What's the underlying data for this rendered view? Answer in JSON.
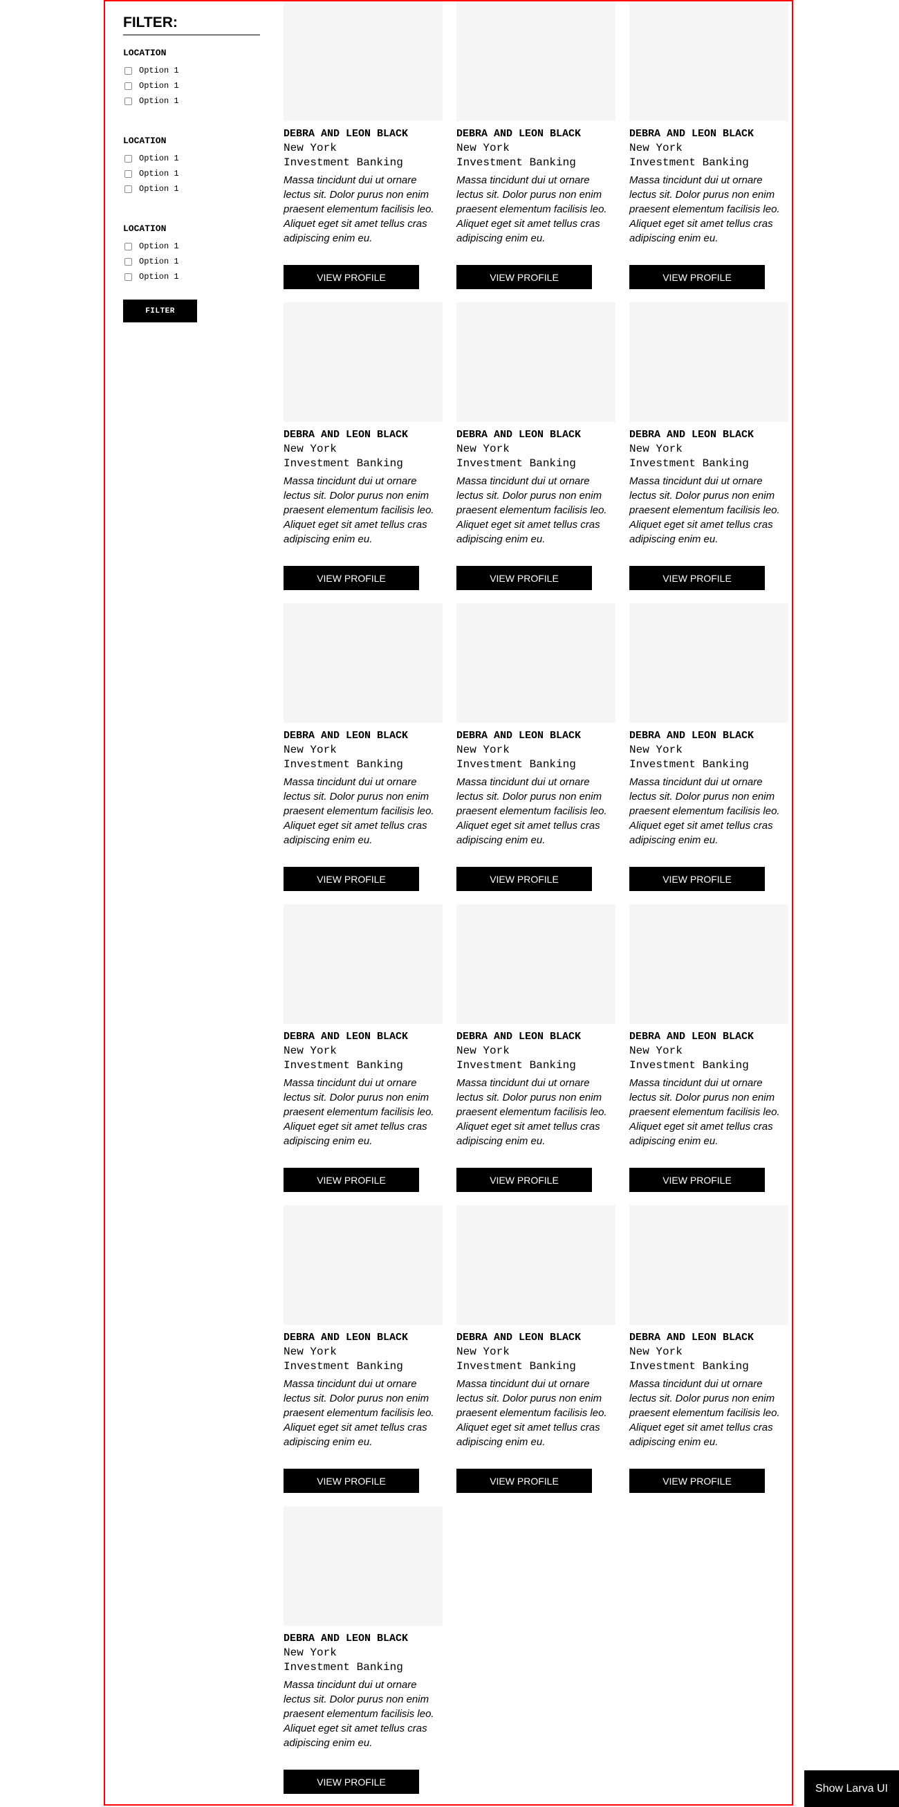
{
  "sidebar": {
    "title": "FILTER:",
    "groups": [
      {
        "title": "LOCATION",
        "options": [
          "Option 1",
          "Option 1",
          "Option 1"
        ]
      },
      {
        "title": "LOCATION",
        "options": [
          "Option 1",
          "Option 1",
          "Option 1"
        ]
      },
      {
        "title": "LOCATION",
        "options": [
          "Option 1",
          "Option 1",
          "Option 1"
        ]
      }
    ],
    "filter_button": "FILTER"
  },
  "profiles": [
    {
      "name": "DEBRA AND LEON BLACK",
      "location": "New York",
      "industry": "Investment Banking",
      "description": "Massa tincidunt dui ut ornare lectus sit. Dolor purus non enim praesent elementum facilisis leo. Aliquet eget sit amet tellus cras adipiscing enim eu.",
      "button": "VIEW PROFILE"
    },
    {
      "name": "DEBRA AND LEON BLACK",
      "location": "New York",
      "industry": "Investment Banking",
      "description": "Massa tincidunt dui ut ornare lectus sit. Dolor purus non enim praesent elementum facilisis leo. Aliquet eget sit amet tellus cras adipiscing enim eu.",
      "button": "VIEW PROFILE"
    },
    {
      "name": "DEBRA AND LEON BLACK",
      "location": "New York",
      "industry": "Investment Banking",
      "description": "Massa tincidunt dui ut ornare lectus sit. Dolor purus non enim praesent elementum facilisis leo. Aliquet eget sit amet tellus cras adipiscing enim eu.",
      "button": "VIEW PROFILE"
    },
    {
      "name": "DEBRA AND LEON BLACK",
      "location": "New York",
      "industry": "Investment Banking",
      "description": "Massa tincidunt dui ut ornare lectus sit. Dolor purus non enim praesent elementum facilisis leo. Aliquet eget sit amet tellus cras adipiscing enim eu.",
      "button": "VIEW PROFILE"
    },
    {
      "name": "DEBRA AND LEON BLACK",
      "location": "New York",
      "industry": "Investment Banking",
      "description": "Massa tincidunt dui ut ornare lectus sit. Dolor purus non enim praesent elementum facilisis leo. Aliquet eget sit amet tellus cras adipiscing enim eu.",
      "button": "VIEW PROFILE"
    },
    {
      "name": "DEBRA AND LEON BLACK",
      "location": "New York",
      "industry": "Investment Banking",
      "description": "Massa tincidunt dui ut ornare lectus sit. Dolor purus non enim praesent elementum facilisis leo. Aliquet eget sit amet tellus cras adipiscing enim eu.",
      "button": "VIEW PROFILE"
    },
    {
      "name": "DEBRA AND LEON BLACK",
      "location": "New York",
      "industry": "Investment Banking",
      "description": "Massa tincidunt dui ut ornare lectus sit. Dolor purus non enim praesent elementum facilisis leo. Aliquet eget sit amet tellus cras adipiscing enim eu.",
      "button": "VIEW PROFILE"
    },
    {
      "name": "DEBRA AND LEON BLACK",
      "location": "New York",
      "industry": "Investment Banking",
      "description": "Massa tincidunt dui ut ornare lectus sit. Dolor purus non enim praesent elementum facilisis leo. Aliquet eget sit amet tellus cras adipiscing enim eu.",
      "button": "VIEW PROFILE"
    },
    {
      "name": "DEBRA AND LEON BLACK",
      "location": "New York",
      "industry": "Investment Banking",
      "description": "Massa tincidunt dui ut ornare lectus sit. Dolor purus non enim praesent elementum facilisis leo. Aliquet eget sit amet tellus cras adipiscing enim eu.",
      "button": "VIEW PROFILE"
    },
    {
      "name": "DEBRA AND LEON BLACK",
      "location": "New York",
      "industry": "Investment Banking",
      "description": "Massa tincidunt dui ut ornare lectus sit. Dolor purus non enim praesent elementum facilisis leo. Aliquet eget sit amet tellus cras adipiscing enim eu.",
      "button": "VIEW PROFILE"
    },
    {
      "name": "DEBRA AND LEON BLACK",
      "location": "New York",
      "industry": "Investment Banking",
      "description": "Massa tincidunt dui ut ornare lectus sit. Dolor purus non enim praesent elementum facilisis leo. Aliquet eget sit amet tellus cras adipiscing enim eu.",
      "button": "VIEW PROFILE"
    },
    {
      "name": "DEBRA AND LEON BLACK",
      "location": "New York",
      "industry": "Investment Banking",
      "description": "Massa tincidunt dui ut ornare lectus sit. Dolor purus non enim praesent elementum facilisis leo. Aliquet eget sit amet tellus cras adipiscing enim eu.",
      "button": "VIEW PROFILE"
    },
    {
      "name": "DEBRA AND LEON BLACK",
      "location": "New York",
      "industry": "Investment Banking",
      "description": "Massa tincidunt dui ut ornare lectus sit. Dolor purus non enim praesent elementum facilisis leo. Aliquet eget sit amet tellus cras adipiscing enim eu.",
      "button": "VIEW PROFILE"
    },
    {
      "name": "DEBRA AND LEON BLACK",
      "location": "New York",
      "industry": "Investment Banking",
      "description": "Massa tincidunt dui ut ornare lectus sit. Dolor purus non enim praesent elementum facilisis leo. Aliquet eget sit amet tellus cras adipiscing enim eu.",
      "button": "VIEW PROFILE"
    },
    {
      "name": "DEBRA AND LEON BLACK",
      "location": "New York",
      "industry": "Investment Banking",
      "description": "Massa tincidunt dui ut ornare lectus sit. Dolor purus non enim praesent elementum facilisis leo. Aliquet eget sit amet tellus cras adipiscing enim eu.",
      "button": "VIEW PROFILE"
    },
    {
      "name": "DEBRA AND LEON BLACK",
      "location": "New York",
      "industry": "Investment Banking",
      "description": "Massa tincidunt dui ut ornare lectus sit. Dolor purus non enim praesent elementum facilisis leo. Aliquet eget sit amet tellus cras adipiscing enim eu.",
      "button": "VIEW PROFILE"
    }
  ],
  "larva_button": "Show Larva UI",
  "colors": {
    "frame_border": "#ff0000",
    "image_placeholder": "#f5f5f5",
    "button_bg": "#000000",
    "button_text": "#ffffff"
  }
}
